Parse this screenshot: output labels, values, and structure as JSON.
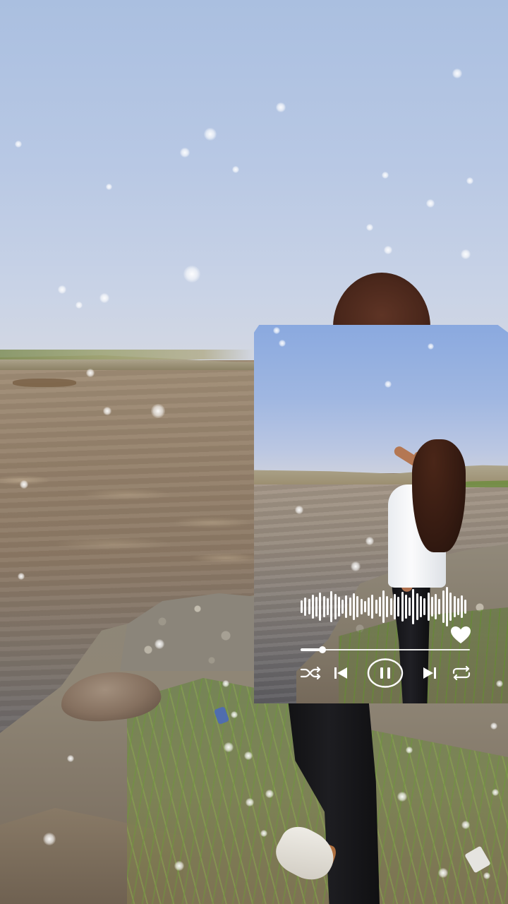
{
  "player": {
    "progress_fraction": 0.13,
    "state": "playing",
    "liked": true,
    "controls": [
      "shuffle-icon",
      "skip-previous-icon",
      "pause-icon",
      "skip-next-icon",
      "repeat-icon"
    ]
  },
  "icons": {
    "shuffle": "shuffle-icon",
    "previous": "skip-previous-icon",
    "pause": "pause-icon",
    "next": "skip-next-icon",
    "repeat": "repeat-icon",
    "like": "heart-icon"
  },
  "colors": {
    "controls": "#ffffff",
    "sky": "#aabfe0",
    "river": "#8c7965"
  }
}
